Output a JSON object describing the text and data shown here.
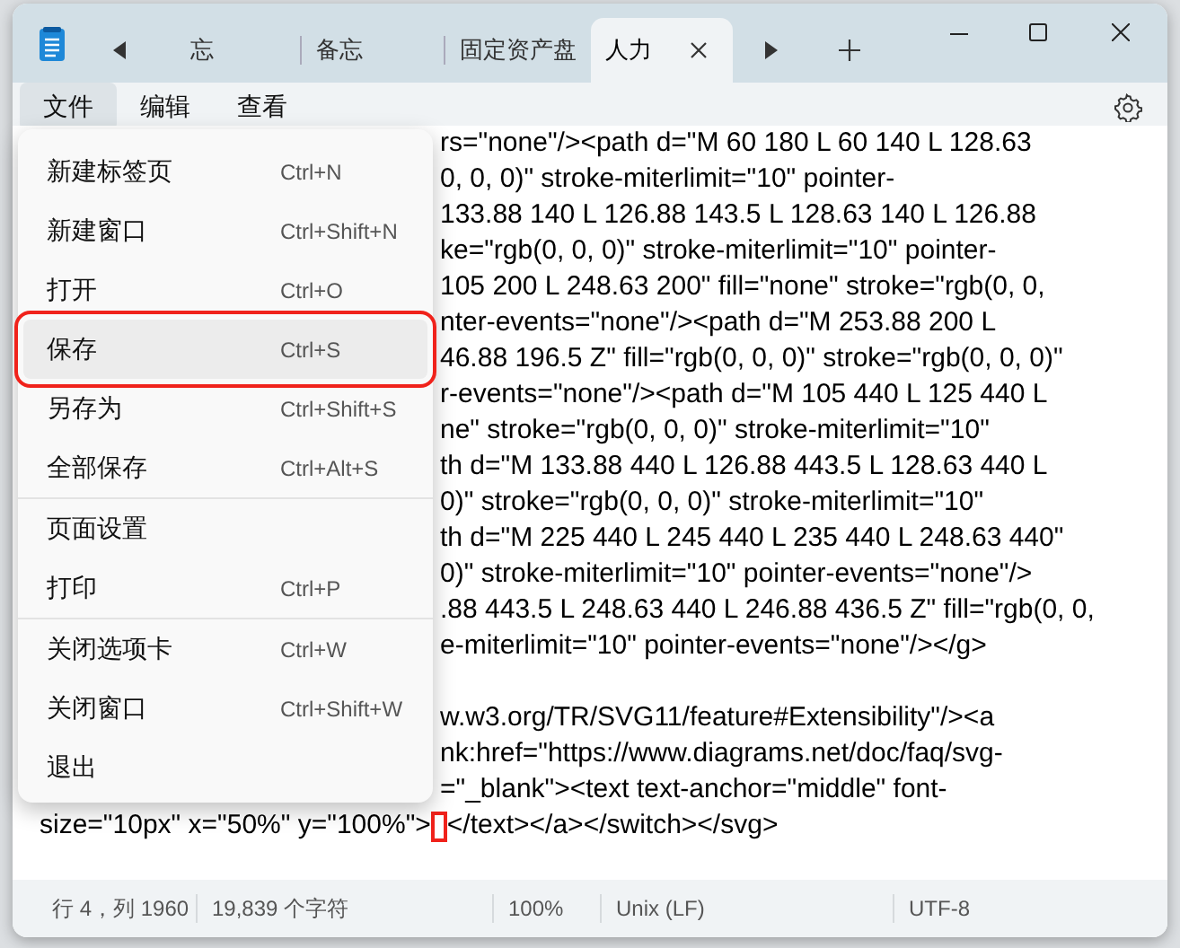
{
  "tabs": [
    {
      "label": "忘",
      "selected": false
    },
    {
      "label": "备忘",
      "selected": false
    },
    {
      "label": "固定资产盘",
      "selected": false
    },
    {
      "label": "人力",
      "selected": true
    }
  ],
  "menubar": [
    {
      "label": "文件",
      "selected": true
    },
    {
      "label": "编辑",
      "selected": false
    },
    {
      "label": "查看",
      "selected": false
    }
  ],
  "menu": [
    {
      "kind": "item",
      "label": "新建标签页",
      "shortcut": "Ctrl+N",
      "selected": false,
      "annotated": false
    },
    {
      "kind": "item",
      "label": "新建窗口",
      "shortcut": "Ctrl+Shift+N",
      "selected": false,
      "annotated": false
    },
    {
      "kind": "item",
      "label": "打开",
      "shortcut": "Ctrl+O",
      "selected": false,
      "annotated": false
    },
    {
      "kind": "item",
      "label": "保存",
      "shortcut": "Ctrl+S",
      "selected": true,
      "annotated": true
    },
    {
      "kind": "item",
      "label": "另存为",
      "shortcut": "Ctrl+Shift+S",
      "selected": false,
      "annotated": false
    },
    {
      "kind": "item",
      "label": "全部保存",
      "shortcut": "Ctrl+Alt+S",
      "selected": false,
      "annotated": false
    },
    {
      "kind": "divider"
    },
    {
      "kind": "item",
      "label": "页面设置",
      "selected": false,
      "annotated": false
    },
    {
      "kind": "item",
      "label": "打印",
      "shortcut": "Ctrl+P",
      "selected": false,
      "annotated": false
    },
    {
      "kind": "divider"
    },
    {
      "kind": "item",
      "label": "关闭选项卡",
      "shortcut": "Ctrl+W",
      "selected": false,
      "annotated": false
    },
    {
      "kind": "item",
      "label": "关闭窗口",
      "shortcut": "Ctrl+Shift+W",
      "selected": false,
      "annotated": false
    },
    {
      "kind": "item",
      "label": "退出",
      "selected": false,
      "annotated": false
    }
  ],
  "editor": {
    "lines": [
      {
        "kind": "clipped",
        "text": "rs=\"none\"/><path d=\"M 60 180 L 60 140 L 128.63"
      },
      {
        "kind": "clipped",
        "text": "0, 0, 0)\" stroke-miterlimit=\"10\" pointer-"
      },
      {
        "kind": "clipped",
        "text": "133.88 140 L 126.88 143.5 L 128.63 140 L 126.88"
      },
      {
        "kind": "clipped",
        "text": "ke=\"rgb(0, 0, 0)\" stroke-miterlimit=\"10\" pointer-"
      },
      {
        "kind": "clipped",
        "text": "105 200 L 248.63 200\" fill=\"none\" stroke=\"rgb(0, 0,"
      },
      {
        "kind": "clipped",
        "text": "nter-events=\"none\"/><path d=\"M 253.88 200 L"
      },
      {
        "kind": "clipped",
        "text": "46.88 196.5 Z\" fill=\"rgb(0, 0, 0)\" stroke=\"rgb(0, 0, 0)\""
      },
      {
        "kind": "clipped",
        "text": "r-events=\"none\"/><path d=\"M 105 440 L 125 440 L"
      },
      {
        "kind": "clipped",
        "text": "ne\" stroke=\"rgb(0, 0, 0)\" stroke-miterlimit=\"10\""
      },
      {
        "kind": "clipped",
        "text": "th d=\"M 133.88 440 L 126.88 443.5 L 128.63 440 L"
      },
      {
        "kind": "clipped",
        "text": "0)\" stroke=\"rgb(0, 0, 0)\" stroke-miterlimit=\"10\""
      },
      {
        "kind": "clipped",
        "text": "th d=\"M 225 440 L 245 440 L 235 440 L 248.63 440\""
      },
      {
        "kind": "clipped",
        "text": "0)\" stroke-miterlimit=\"10\" pointer-events=\"none\"/>"
      },
      {
        "kind": "clipped",
        "text": ".88 443.5 L 248.63 440 L 246.88 436.5 Z\" fill=\"rgb(0, 0,"
      },
      {
        "kind": "clipped",
        "text": "e-miterlimit=\"10\" pointer-events=\"none\"/></g>"
      },
      {
        "kind": "blank"
      },
      {
        "kind": "clipped",
        "text": "w.w3.org/TR/SVG11/feature#Extensibility\"/><a"
      },
      {
        "kind": "clipped",
        "text": "nk:href=\"https://www.diagrams.net/doc/faq/svg-"
      },
      {
        "kind": "clipped",
        "text": "=\"_blank\"><text text-anchor=\"middle\" font-"
      },
      {
        "kind": "full",
        "text": "size=\"10px\" x=\"50%\" y=\"100%\">",
        "marked": true,
        "text_after": "</text></a></switch></svg>"
      }
    ]
  },
  "status_bar": [
    "行 4，列 1960",
    "19,839 个字符",
    "100%",
    "Unix (LF)",
    "UTF-8"
  ]
}
